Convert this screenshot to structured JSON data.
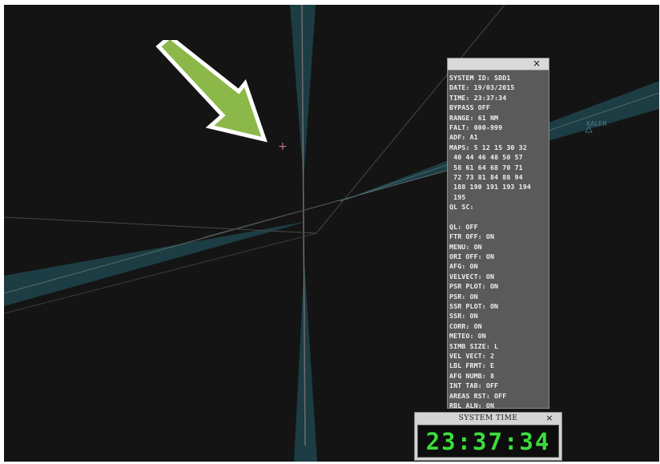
{
  "info_panel": {
    "lines": [
      "SYSTEM ID: SDD1",
      "DATE: 19/03/2015",
      "TIME: 23:37:34",
      "BYPASS OFF",
      "RANGE: 61 NM",
      "FALT: 000-999",
      "ADF: A1",
      "MAPS: 5 12 15 30 32",
      " 40 44 46 48 50 57",
      " 58 61 64 68 70 71",
      " 72 73 81 84 88 94",
      " 188 190 191 193 194",
      " 195",
      "QL SC:",
      "",
      "QL: OFF",
      "FTR OFF: ON",
      "MENU: ON",
      "ORI OFF: ON",
      "AFG: ON",
      "VELVECT: ON",
      "PSR PLOT: ON",
      "PSR: ON",
      "SSR PLOT: ON",
      "SSR: ON",
      "CORR: ON",
      "METEO: ON",
      "SIMB SIZE: L",
      "VEL VECT: 2",
      "LBL FRMT: E",
      "AFG NUMB: 8",
      "INT TAB: OFF",
      "AREAS RST: OFF",
      "RBL ALN: ON"
    ],
    "close_label": "×"
  },
  "time_window": {
    "title": "SYSTEM TIME",
    "close_label": "×",
    "time": "23:37:34"
  },
  "map": {
    "fix_label": "KALER",
    "cursor_symbol": "+"
  },
  "colors": {
    "background": "#141414",
    "sector_fill": "#1c3d43",
    "clock_digits": "#3ddc3d",
    "annotation_arrow": "#8cb84a",
    "cursor": "#c0739a"
  }
}
